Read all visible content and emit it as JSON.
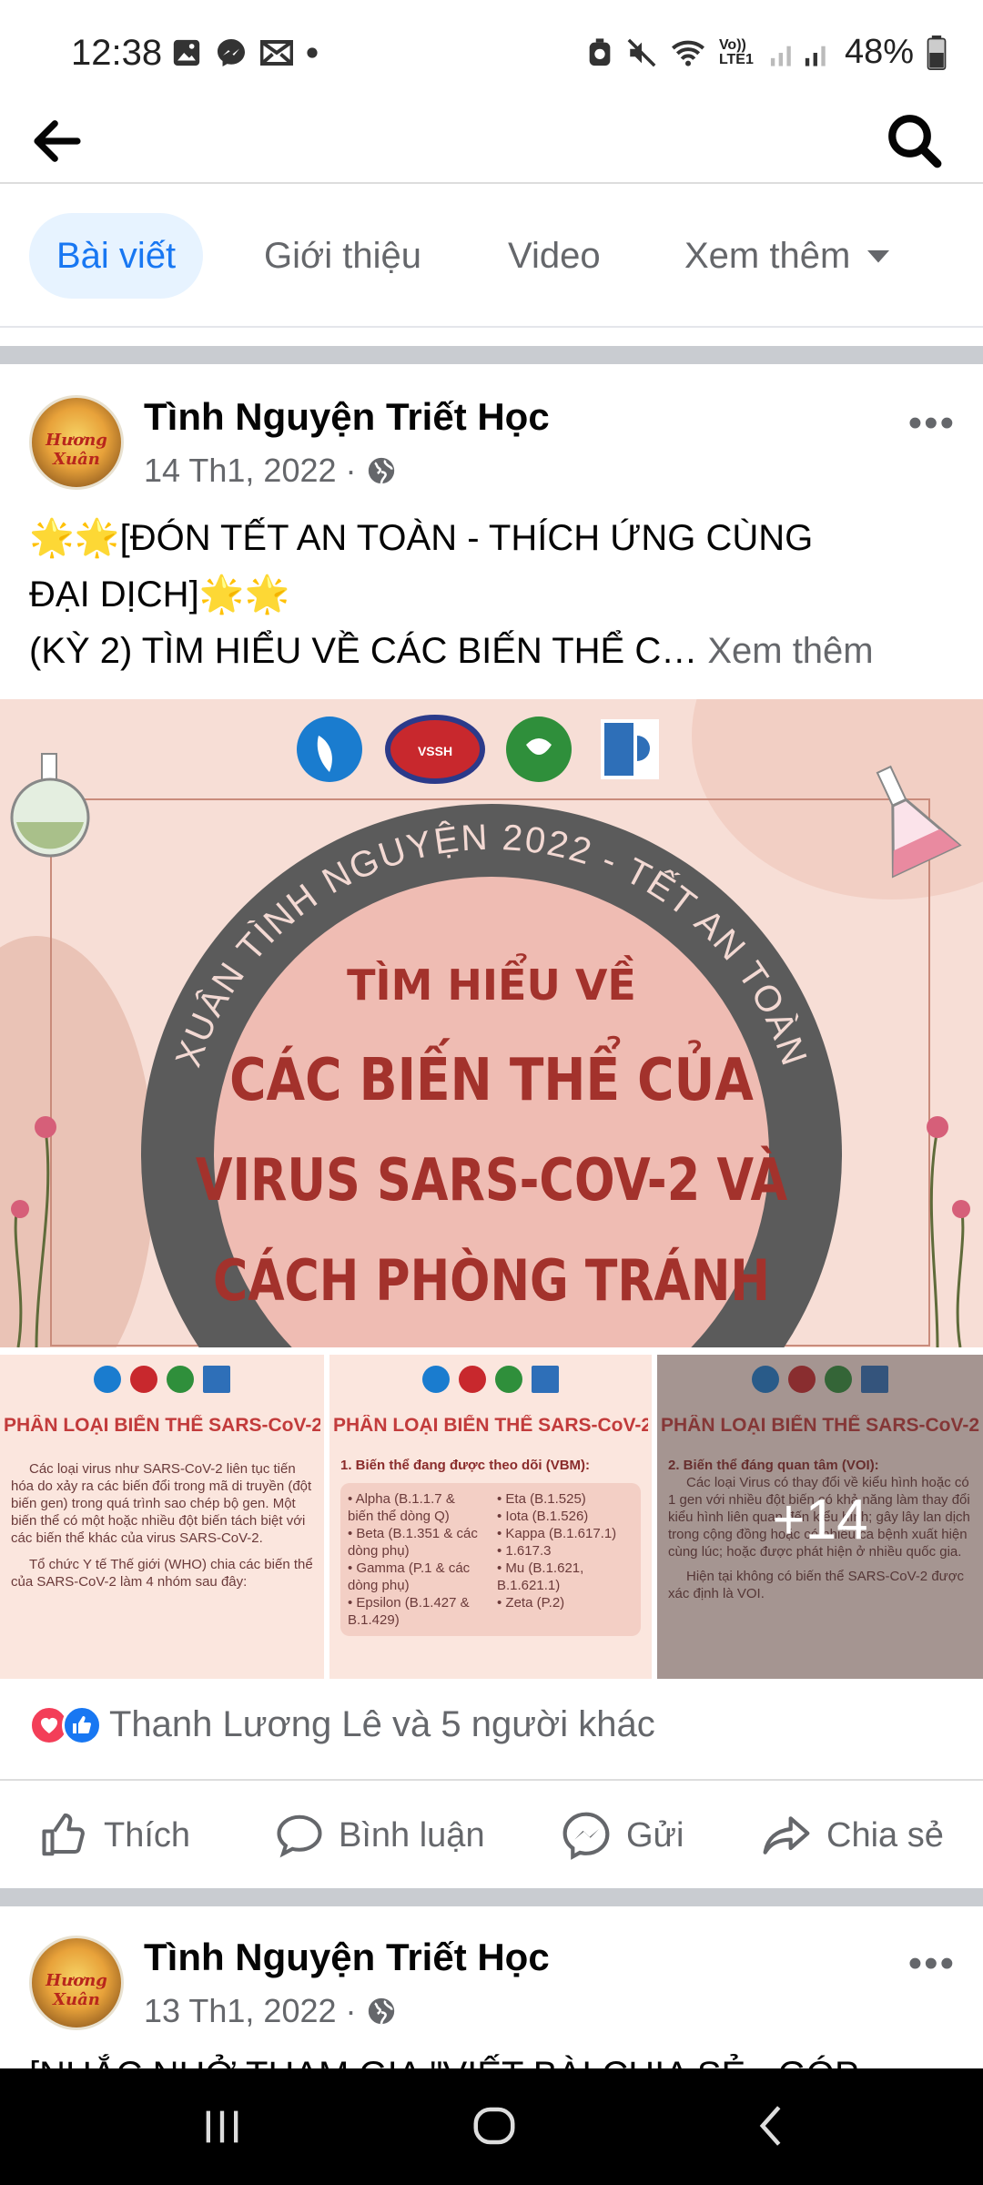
{
  "status_bar": {
    "time": "12:38",
    "battery": "48%",
    "network_label": "Vo)) LTE1",
    "icons_left": [
      "gallery-icon",
      "messenger-icon",
      "mail-icon",
      "dot-icon"
    ],
    "icons_right": [
      "alarm-icon",
      "mute-icon",
      "wifi-icon",
      "signal-icon",
      "battery-icon"
    ]
  },
  "topbar": {
    "back_icon": "arrow-left-icon",
    "search_icon": "search-icon"
  },
  "tabs": [
    {
      "label": "Bài viết",
      "active": true
    },
    {
      "label": "Giới thiệu",
      "active": false
    },
    {
      "label": "Video",
      "active": false
    },
    {
      "label": "Xem thêm",
      "active": false
    }
  ],
  "posts": [
    {
      "page_name": "Tình Nguyện Triết Học",
      "date": "14 Th1, 2022",
      "avatar_text": "Hương Xuân",
      "text_line1": "🌟🌟[ĐÓN TẾT AN TOÀN - THÍCH ỨNG CÙNG",
      "text_line2": "ĐẠI DỊCH]🌟🌟",
      "text_line3": "(KỲ 2) TÌM HIỂU VỀ CÁC BIẾN THỂ C…",
      "see_more": "Xem thêm",
      "hero": {
        "ring_text": "XUÂN TÌNH NGUYỆN 2022 - TẾT AN TOÀN",
        "line1": "TÌM HIỂU VỀ",
        "line2": "CÁC BIẾN THỂ CỦA",
        "line3": "VIRUS SARS-COV-2 VÀ",
        "line4": "CÁCH PHÒNG TRÁNH",
        "logo_text": "VSSH"
      },
      "thumbs": [
        {
          "title": "PHÂN LOẠI BIẾN THỂ SARS-CoV-2",
          "body1": "Các loại virus như SARS-CoV-2 liên tục tiến hóa do xảy ra các biến đổi trong mã di truyền (đột biến gen) trong quá trình sao chép bộ gen. Một biến thể có một hoặc nhiều đột biến tách biệt với các biến thể khác của virus SARS-CoV-2.",
          "body2": "Tổ chức Y tế Thế giới (WHO) chia các biến thể của SARS-CoV-2 làm 4 nhóm sau đây:"
        },
        {
          "title": "PHÂN LOẠI BIẾN THỂ SARS-CoV-2",
          "heading": "1. Biến thể đang được theo dõi (VBM):",
          "col1": [
            "• Alpha (B.1.1.7 & biến thể dòng Q)",
            "• Beta (B.1.351 & các dòng phụ)",
            "• Gamma (P.1 & các dòng phụ)",
            "• Epsilon (B.1.427 & B.1.429)"
          ],
          "col2": [
            "• Eta (B.1.525)",
            "• Iota (B.1.526)",
            "• Kappa (B.1.617.1)",
            "• 1.617.3",
            "• Mu (B.1.621, B.1.621.1)",
            "• Zeta (P.2)"
          ]
        },
        {
          "title": "PHÂN LOẠI BIẾN THỂ SARS-CoV-2",
          "heading": "2. Biến thể đáng quan tâm (VOI):",
          "body1": "Các loại Virus có thay đổi về kiểu hình hoặc có 1 gen với nhiều đột biến có khả năng làm thay đổi kiểu hình liên quan đến kiểu hình; gây lây lan dịch trong cộng đồng hoặc có nhiều ca bệnh xuất hiện cùng lúc; hoặc được phát hiện ở nhiều quốc gia.",
          "body2": "Hiện tại không có biến thể SARS-CoV-2 được xác định là VOI.",
          "overlay": "+14"
        }
      ],
      "reactions_text": "Thanh Lương Lê và 5 người khác",
      "actions": {
        "like": "Thích",
        "comment": "Bình luận",
        "send": "Gửi",
        "share": "Chia sẻ"
      }
    },
    {
      "page_name": "Tình Nguyện Triết Học",
      "date": "13 Th1, 2022",
      "avatar_text": "Hương Xuân",
      "text_line1": "[NHẮC NHỞ THAM GIA \"VIẾT BÀI CHIA SẺ - GÓP"
    }
  ],
  "colors": {
    "accent": "#1877f2",
    "tab_active_bg": "#e7f3ff",
    "secondary_text": "#65676b",
    "hero_bg": "#f7ded6",
    "ring": "#555555",
    "hero_title": "#a3322c"
  }
}
